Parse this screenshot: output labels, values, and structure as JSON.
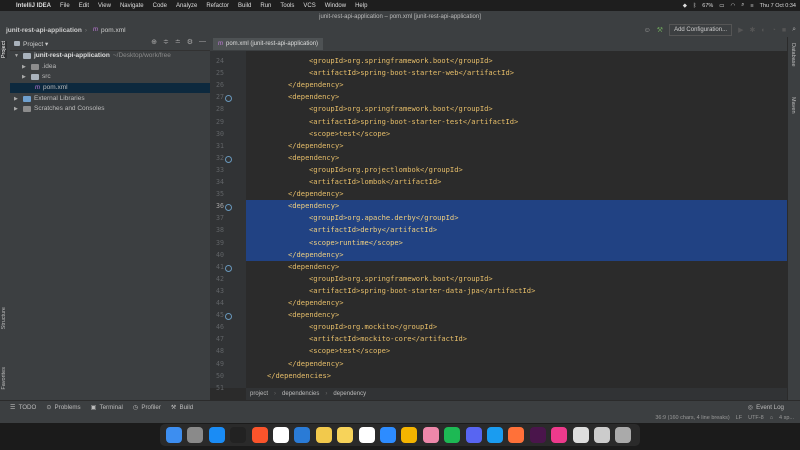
{
  "menubar": {
    "app_name": "IntelliJ IDEA",
    "items": [
      "File",
      "Edit",
      "View",
      "Navigate",
      "Code",
      "Analyze",
      "Refactor",
      "Build",
      "Run",
      "Tools",
      "VCS",
      "Window",
      "Help"
    ],
    "battery": "67%",
    "datetime": "Thu 7 Oct 0:34"
  },
  "window": {
    "title": "junit-rest-api-application – pom.xml [junit-rest-api-application]"
  },
  "navbar": {
    "project": "junit-rest-api-application",
    "file": "pom.xml",
    "run_config": "Add Configuration..."
  },
  "project_panel": {
    "header": "Project",
    "tree": [
      {
        "label": "junit-rest-api-application",
        "path": "~/Desktop/work/free",
        "indent": 0,
        "expanded": true,
        "icon": "folder-icon"
      },
      {
        "label": ".idea",
        "indent": 1,
        "expanded": false,
        "icon": "folder-icon"
      },
      {
        "label": "src",
        "indent": 1,
        "expanded": false,
        "icon": "folder-icon"
      },
      {
        "label": "pom.xml",
        "indent": 1,
        "icon": "maven-file-icon"
      },
      {
        "label": "External Libraries",
        "indent": 0,
        "expanded": false,
        "icon": "library-icon"
      },
      {
        "label": "Scratches and Consoles",
        "indent": 0,
        "expanded": false,
        "icon": "scratches-icon"
      }
    ]
  },
  "editor": {
    "tab_label": "pom.xml (junit-rest-api-application)",
    "current_line": "36",
    "lines": [
      {
        "n": "24",
        "indent": 2,
        "text": "<groupId>org.springframework.boot</groupId>"
      },
      {
        "n": "25",
        "indent": 2,
        "text": "<artifactId>spring-boot-starter-web</artifactId>"
      },
      {
        "n": "26",
        "indent": 1,
        "text": "</dependency>"
      },
      {
        "n": "27",
        "indent": 1,
        "text": "<dependency>"
      },
      {
        "n": "28",
        "indent": 2,
        "text": "<groupId>org.springframework.boot</groupId>"
      },
      {
        "n": "29",
        "indent": 2,
        "text": "<artifactId>spring-boot-starter-test</artifactId>"
      },
      {
        "n": "30",
        "indent": 2,
        "text": "<scope>test</scope>"
      },
      {
        "n": "31",
        "indent": 1,
        "text": "</dependency>"
      },
      {
        "n": "32",
        "indent": 1,
        "text": "<dependency>"
      },
      {
        "n": "33",
        "indent": 2,
        "text": "<groupId>org.projectlombok</groupId>"
      },
      {
        "n": "34",
        "indent": 2,
        "text": "<artifactId>lombok</artifactId>"
      },
      {
        "n": "35",
        "indent": 1,
        "text": "</dependency>"
      },
      {
        "n": "36",
        "indent": 1,
        "text": "<dependency>"
      },
      {
        "n": "37",
        "indent": 2,
        "text": "<groupId>org.apache.derby</groupId>"
      },
      {
        "n": "38",
        "indent": 2,
        "text": "<artifactId>derby</artifactId>"
      },
      {
        "n": "39",
        "indent": 2,
        "text": "<scope>runtime</scope>"
      },
      {
        "n": "40",
        "indent": 1,
        "text": "</dependency>"
      },
      {
        "n": "41",
        "indent": 1,
        "text": "<dependency>"
      },
      {
        "n": "42",
        "indent": 2,
        "text": "<groupId>org.springframework.boot</groupId>"
      },
      {
        "n": "43",
        "indent": 2,
        "text": "<artifactId>spring-boot-starter-data-jpa</artifactId>"
      },
      {
        "n": "44",
        "indent": 1,
        "text": "</dependency>"
      },
      {
        "n": "45",
        "indent": 1,
        "text": "<dependency>"
      },
      {
        "n": "46",
        "indent": 2,
        "text": "<groupId>org.mockito</groupId>"
      },
      {
        "n": "47",
        "indent": 2,
        "text": "<artifactId>mockito-core</artifactId>"
      },
      {
        "n": "48",
        "indent": 2,
        "text": "<scope>test</scope>"
      },
      {
        "n": "49",
        "indent": 1,
        "text": "</dependency>"
      },
      {
        "n": "50",
        "indent": 0,
        "text": "</dependencies>"
      },
      {
        "n": "51",
        "indent": 0,
        "text": ""
      }
    ],
    "gutter_icons_lines": [
      "27",
      "32",
      "36",
      "41",
      "45"
    ],
    "breadcrumb": [
      "project",
      "dependencies",
      "dependency"
    ]
  },
  "right_strip": [
    "Database",
    "Maven"
  ],
  "left_strip": [
    "Project",
    "Structure",
    "Favorites"
  ],
  "bottom_tools": [
    {
      "label": "TODO",
      "icon": "todo-icon"
    },
    {
      "label": "Problems",
      "icon": "problems-icon"
    },
    {
      "label": "Terminal",
      "icon": "terminal-icon"
    },
    {
      "label": "Profiler",
      "icon": "profiler-icon"
    },
    {
      "label": "Build",
      "icon": "build-icon"
    }
  ],
  "event_log": "Event Log",
  "status": {
    "position": "36:9 (160 chars, 4 line breaks)",
    "line_sep": "LF",
    "encoding": "UTF-8",
    "indent": "4 sp..."
  },
  "dock_apps": [
    "Finder",
    "Launchpad",
    "App Store",
    "Terminal",
    "Brave",
    "Calendar",
    "VS Code",
    "Hand Mirror",
    "Notes",
    "Notion",
    "Zoom",
    "Chrome",
    "Photos",
    "Spotify",
    "Discord",
    "Safari",
    "Firefox",
    "Slack",
    "IntelliJ IDEA",
    "Preview",
    "Files",
    "Trash"
  ]
}
